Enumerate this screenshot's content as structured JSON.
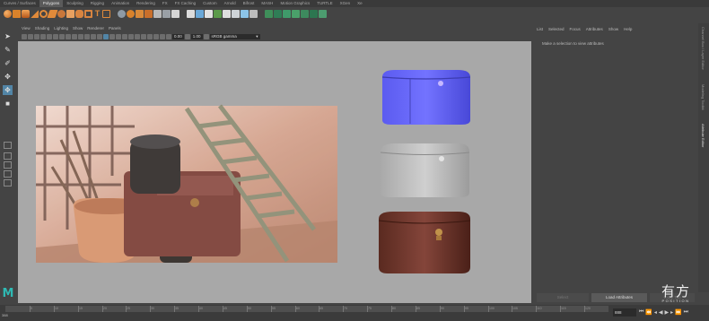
{
  "shelf_tabs": [
    "Curves / Surfaces",
    "Polygons",
    "Sculpting",
    "Rigging",
    "Animation",
    "Rendering",
    "FX",
    "FX Caching",
    "Custom",
    "Arnold",
    "Bifrost",
    "MASH",
    "Motion Graphics",
    "TURTLE",
    "XGen",
    "Xe"
  ],
  "active_shelf_tab": "Polygons",
  "panel_menu": [
    "View",
    "Shading",
    "Lighting",
    "Show",
    "Renderer",
    "Panels"
  ],
  "panel_toolbar": {
    "exposure_value": "0.00",
    "gamma_value": "1.00",
    "color_space": "sRGB gamma"
  },
  "attribute_editor": {
    "menu": [
      "List",
      "Selected",
      "Focus",
      "Attributes",
      "Show",
      "Help"
    ],
    "message": "Make a selection to view attributes",
    "vertical_tabs": [
      "Channel Box / Layer Editor",
      "Modeling Toolkit",
      "Attribute Editor"
    ],
    "active_vertical_tab": "Attribute Editor",
    "buttons": {
      "select": "Select",
      "load": "Load Attributes",
      "copy": "Copy Tab"
    }
  },
  "timeline": {
    "start_frame": "388",
    "tick_labels": [
      "5",
      "10",
      "15",
      "20",
      "25",
      "30",
      "35",
      "40",
      "45",
      "50",
      "55",
      "60",
      "65",
      "70",
      "75",
      "80",
      "85",
      "90",
      "95",
      "100",
      "105",
      "110",
      "115",
      "120"
    ],
    "current_frame": "888"
  },
  "watermark": {
    "chinese": "有方",
    "english": "POSITION"
  },
  "colors": {
    "accent_blue": "#5285a6",
    "maya_teal": "#2fb9b3",
    "viewport_bg": "#a8a8a8"
  }
}
